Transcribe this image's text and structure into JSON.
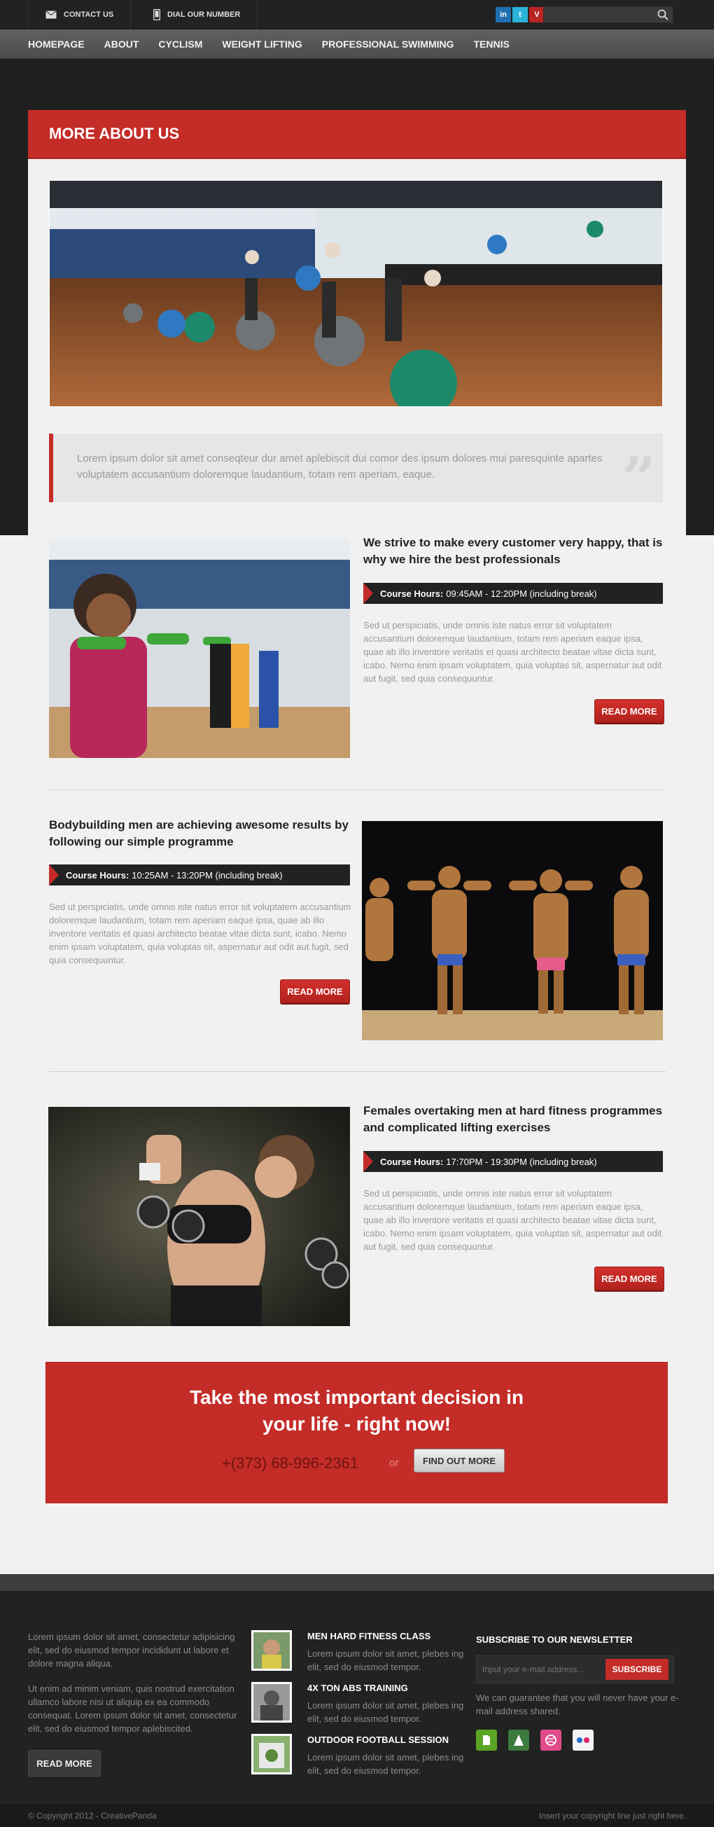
{
  "topbar": {
    "contact_label": "CONTACT US",
    "dial_label": "DIAL OUR NUMBER",
    "search_placeholder": "",
    "social": [
      {
        "name": "linkedin-icon",
        "glyph": "in",
        "color": "#1f6fb0"
      },
      {
        "name": "twitter-icon",
        "glyph": "t",
        "color": "#2ab2d8"
      },
      {
        "name": "vimeo-icon",
        "glyph": "V",
        "color": "#b82522"
      }
    ]
  },
  "nav": {
    "items": [
      "HOMEPAGE",
      "ABOUT",
      "CYCLISM",
      "WEIGHT LIFTING",
      "PROFESSIONAL SWIMMING",
      "TENNIS"
    ]
  },
  "section": {
    "title": "MORE ABOUT US",
    "quote": "Lorem ipsum dolor sit amet conseqteur dur amet aplebiscit dui comor des ipsum dolores mui paresquinte apartes voluptatem accusantium doloremque laudantium, totam rem aperiam, eaque."
  },
  "features": [
    {
      "title": "We strive to make every customer very happy, that is why we hire the best professionals",
      "hours_label": "Course Hours:",
      "hours_value": "09:45AM - 12:20PM (including break)",
      "desc": "Sed ut perspiciatis, unde omnis iste natus error sit voluptatem accusantium doloremque laudantium, totam rem aperiam eaque ipsa, quae ab illo inventore veritatis et quasi architecto beatae vitae dicta sunt, icabo. Nemo enim ipsam voluptatem, quia voluptas sit, aspernatur aut odit aut fugit, sed quia consequuntur.",
      "button": "READ MORE"
    },
    {
      "title": "Bodybuilding men are achieving awesome results by following our simple programme",
      "hours_label": "Course Hours:",
      "hours_value": "10:25AM - 13:20PM (including break)",
      "desc": "Sed ut perspiciatis, unde omnis iste natus error sit voluptatem accusantium doloremque laudantium, totam rem aperiam eaque ipsa, quae ab illo inventore veritatis et quasi architecto beatae vitae dicta sunt, icabo. Nemo enim ipsam voluptatem, quia voluptas sit, aspernatur aut odit aut fugit, sed quia consequuntur.",
      "button": "READ MORE"
    },
    {
      "title": "Females overtaking men at hard fitness programmes and complicated lifting exercises",
      "hours_label": "Course Hours:",
      "hours_value": "17:70PM - 19:30PM (including break)",
      "desc": "Sed ut perspiciatis, unde omnis iste natus error sit voluptatem accusantium doloremque laudantium, totam rem aperiam eaque ipsa, quae ab illo inventore veritatis et quasi architecto beatae vitae dicta sunt, icabo. Nemo enim ipsam voluptatem, quia voluptas sit, aspernatur aut odit aut fugit, sed quia consequuntur.",
      "button": "READ MORE"
    }
  ],
  "cta": {
    "line1": "Take the most important decision in",
    "line2": "your life - right now!",
    "phone": "+(373) 68-996-2361",
    "or": "or",
    "button": "FIND OUT MORE"
  },
  "footer": {
    "about_p1": "Lorem ipsum dolor sit amet, consectetur adipisicing elit, sed do eiusmod tempor incididunt ut labore et dolore magna aliqua.",
    "about_p2": "Ut enim ad minim veniam, quis nostrud exercitation ullamco labore nisi ut aliquip ex ea commodo consequat. Lorem ipsum dolor sit amet, consectetur elit, sed do eiusmod tempor aplebiscited.",
    "about_button": "READ MORE",
    "items": [
      {
        "title": "MEN HARD FITNESS CLASS",
        "text": "Lorem ipsum dolor sit amet, plebes ing elit, sed do eiusmod tempor."
      },
      {
        "title": "4X TON ABS TRAINING",
        "text": "Lorem ipsum dolor sit amet, plebes ing elit, sed do eiusmod tempor."
      },
      {
        "title": "OUTDOOR FOOTBALL SESSION",
        "text": "Lorem ipsum dolor sit amet, plebes ing elit, sed do eiusmod tempor."
      }
    ],
    "newsletter": {
      "title": "SUBSCRIBE TO OUR NEWSLETTER",
      "placeholder": "Input your e-mail address...",
      "button": "SUBSCRIBE",
      "note": "We can guarantee that you will never have your e-mail address shared."
    },
    "social": [
      {
        "name": "evernote-icon",
        "color": "#5ba525"
      },
      {
        "name": "forrst-icon",
        "color": "#3c7a3e"
      },
      {
        "name": "dribbble-icon",
        "color": "#e04b8b"
      },
      {
        "name": "flickr-icon",
        "color": "#f3f3f3"
      }
    ]
  },
  "bottombar": {
    "copyright": "© Copyright 2012 - CreativePanda",
    "right_text": "Insert your copyright line just right here."
  }
}
